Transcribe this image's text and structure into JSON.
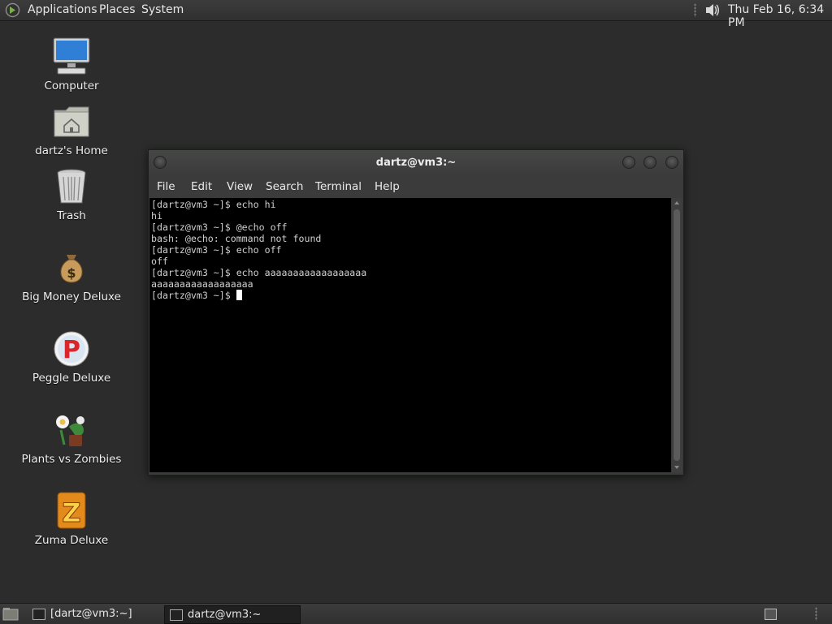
{
  "top_panel": {
    "menus": [
      "Applications",
      "Places",
      "System"
    ],
    "clock": "Thu Feb 16,  6:34 PM"
  },
  "desktop": {
    "icons": [
      {
        "label": "Computer",
        "icon": "computer-icon"
      },
      {
        "label": "dartz's Home",
        "icon": "home-folder-icon"
      },
      {
        "label": "Trash",
        "icon": "trash-icon"
      },
      {
        "label": "Big Money Deluxe",
        "icon": "money-bag-icon"
      },
      {
        "label": "Peggle Deluxe",
        "icon": "peggle-icon"
      },
      {
        "label": "Plants vs Zombies",
        "icon": "plants-vs-zombies-icon"
      },
      {
        "label": "Zuma Deluxe",
        "icon": "zuma-icon"
      }
    ]
  },
  "terminal": {
    "title": "dartz@vm3:~",
    "menu": [
      "File",
      "Edit",
      "View",
      "Search",
      "Terminal",
      "Help"
    ],
    "lines": [
      "[dartz@vm3 ~]$ echo hi",
      "hi",
      "[dartz@vm3 ~]$ @echo off",
      "bash: @echo: command not found",
      "[dartz@vm3 ~]$ echo off",
      "off",
      "[dartz@vm3 ~]$ echo aaaaaaaaaaaaaaaaaa",
      "aaaaaaaaaaaaaaaaaa"
    ],
    "prompt": "[dartz@vm3 ~]$ "
  },
  "taskbar": {
    "tasks": [
      "[dartz@vm3:~]",
      "dartz@vm3:~"
    ]
  },
  "colors": {
    "desktop_bg": "#2b2c2b",
    "terminal_bg": "#000000",
    "terminal_fg": "#cfcfcf"
  }
}
